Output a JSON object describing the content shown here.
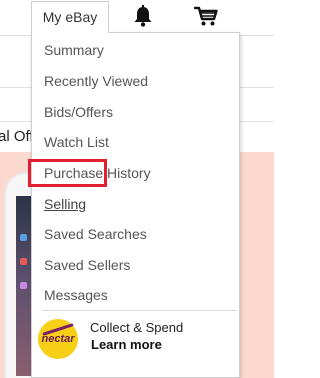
{
  "header": {
    "my_ebay_label": "My eBay",
    "icons": [
      "bell-icon",
      "cart-icon"
    ]
  },
  "background": {
    "partial_text": "al Off"
  },
  "menu": {
    "items": [
      {
        "label": "Summary"
      },
      {
        "label": "Recently Viewed"
      },
      {
        "label": "Bids/Offers"
      },
      {
        "label": "Watch List"
      },
      {
        "label": "Purchase History"
      },
      {
        "label": "Selling"
      },
      {
        "label": "Saved Searches"
      },
      {
        "label": "Saved Sellers"
      },
      {
        "label": "Messages"
      }
    ],
    "highlighted_item": "Selling",
    "promo": {
      "logo_text": "nectar",
      "title": "Collect & Spend",
      "link": "Learn more"
    }
  },
  "colors": {
    "highlight": "#e0202e",
    "hero_background": "#fbd9cf",
    "nectar_yellow": "#f6cf16"
  }
}
